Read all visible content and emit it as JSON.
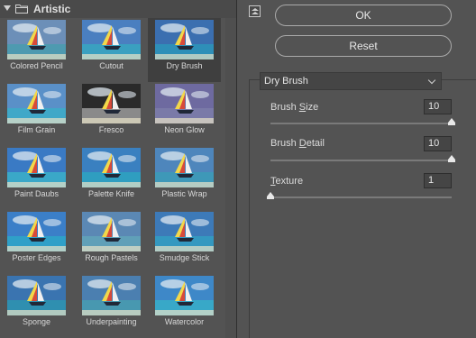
{
  "category": {
    "label": "Artistic"
  },
  "filters": [
    {
      "label": "Colored Pencil",
      "selected": false
    },
    {
      "label": "Cutout",
      "selected": false
    },
    {
      "label": "Dry Brush",
      "selected": true
    },
    {
      "label": "Film Grain",
      "selected": false
    },
    {
      "label": "Fresco",
      "selected": false
    },
    {
      "label": "Neon Glow",
      "selected": false
    },
    {
      "label": "Paint Daubs",
      "selected": false
    },
    {
      "label": "Palette Knife",
      "selected": false
    },
    {
      "label": "Plastic Wrap",
      "selected": false
    },
    {
      "label": "Poster Edges",
      "selected": false
    },
    {
      "label": "Rough Pastels",
      "selected": false
    },
    {
      "label": "Smudge Stick",
      "selected": false
    },
    {
      "label": "Sponge",
      "selected": false
    },
    {
      "label": "Underpainting",
      "selected": false
    },
    {
      "label": "Watercolor",
      "selected": false
    }
  ],
  "buttons": {
    "ok": "OK",
    "reset": "Reset"
  },
  "filter_select": {
    "value": "Dry Brush"
  },
  "params": [
    {
      "label_pre": "Brush ",
      "label_key": "S",
      "label_post": "ize",
      "value": "10",
      "level": 1.0
    },
    {
      "label_pre": "Brush ",
      "label_key": "D",
      "label_post": "etail",
      "value": "10",
      "level": 1.0
    },
    {
      "label_pre": "",
      "label_key": "T",
      "label_post": "exture",
      "value": "1",
      "level": 0.0
    }
  ]
}
